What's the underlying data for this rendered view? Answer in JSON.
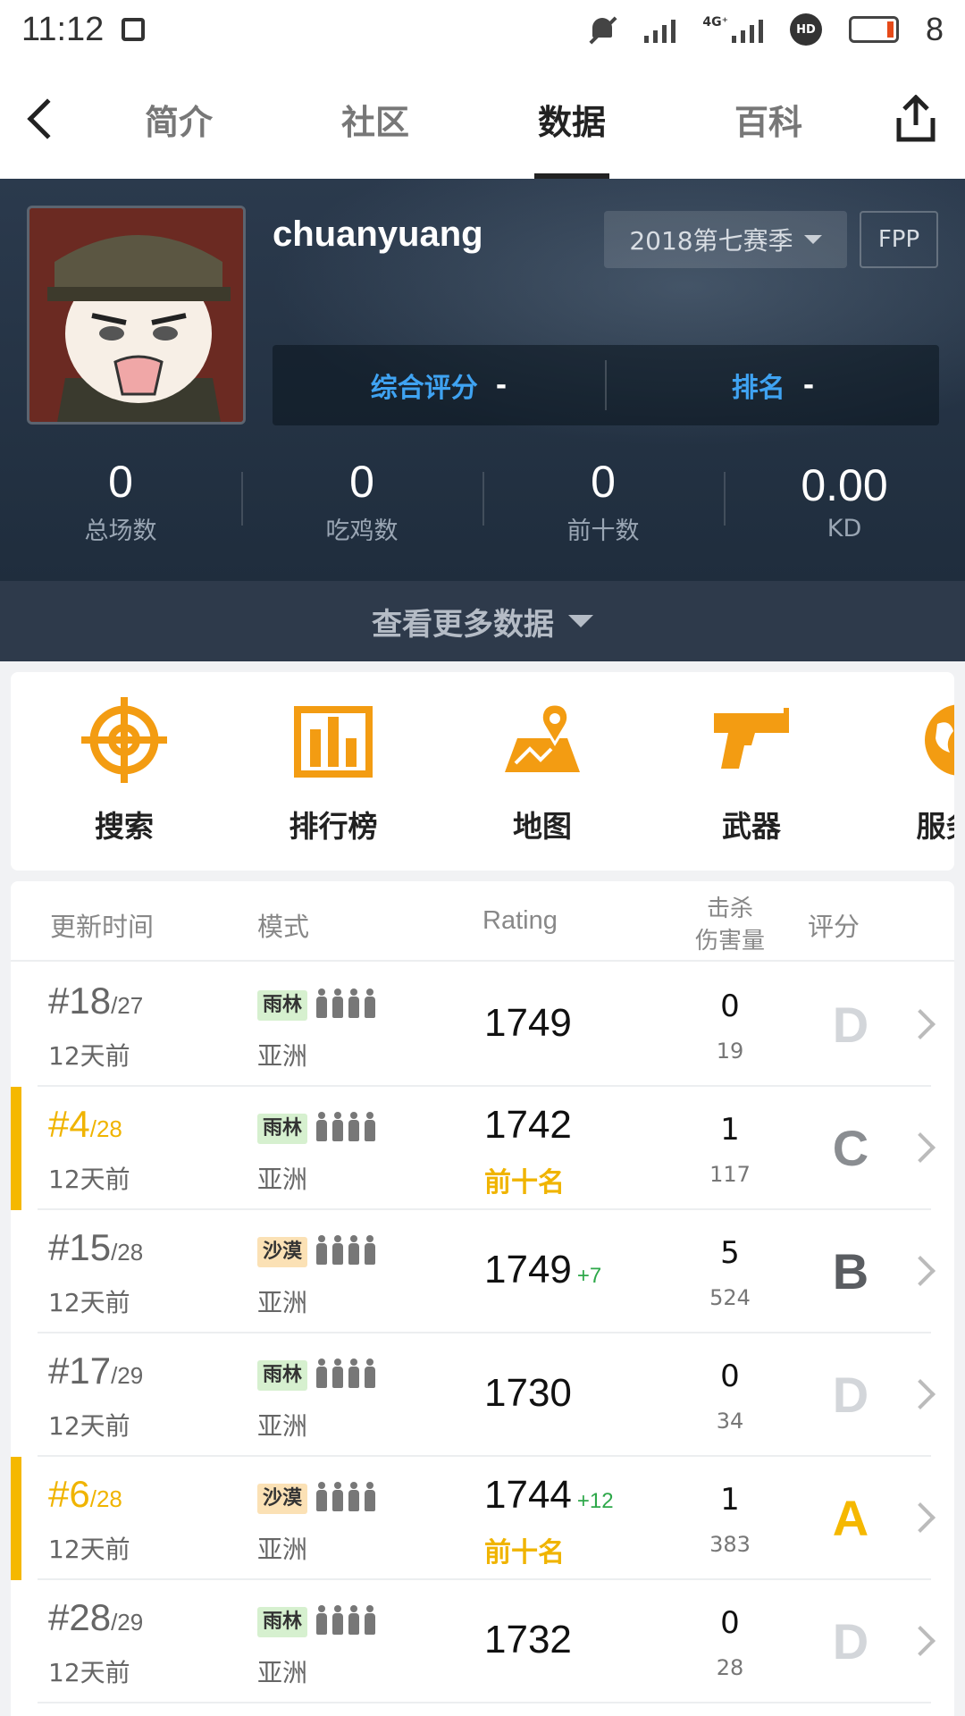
{
  "status_bar": {
    "time": "11:12",
    "network": "4G⁺",
    "hd": "HD",
    "battery": "8"
  },
  "nav": {
    "tabs": [
      "简介",
      "社区",
      "数据",
      "百科"
    ],
    "active_tab": 2
  },
  "profile": {
    "username": "chuanyuang",
    "season": "2018第七赛季",
    "mode": "FPP",
    "overall_rating_label": "综合评分",
    "overall_rating_value": "-",
    "rank_label": "排名",
    "rank_value": "-",
    "stats": [
      {
        "value": "0",
        "label": "总场数"
      },
      {
        "value": "0",
        "label": "吃鸡数"
      },
      {
        "value": "0",
        "label": "前十数"
      },
      {
        "value": "0.00",
        "label": "KD"
      }
    ],
    "more_data": "查看更多数据"
  },
  "quick_menu": [
    {
      "label": "搜索",
      "icon": "crosshair-icon"
    },
    {
      "label": "排行榜",
      "icon": "leaderboard-icon"
    },
    {
      "label": "地图",
      "icon": "map-icon"
    },
    {
      "label": "武器",
      "icon": "pistol-icon"
    },
    {
      "label": "服务器",
      "icon": "globe-icon"
    }
  ],
  "table": {
    "headers": {
      "time": "更新时间",
      "mode": "模式",
      "rating": "Rating",
      "kills_line1": "击杀",
      "kills_line2": "伤害量",
      "grade": "评分"
    },
    "rows": [
      {
        "rank": "#18",
        "total": "/27",
        "ago": "12天前",
        "map": "雨林",
        "map_type": "jungle",
        "region": "亚洲",
        "rating": "1749",
        "delta": "",
        "top10": "",
        "kills": "0",
        "damage": "19",
        "grade": "D",
        "highlight": false
      },
      {
        "rank": "#4",
        "total": "/28",
        "ago": "12天前",
        "map": "雨林",
        "map_type": "jungle",
        "region": "亚洲",
        "rating": "1742",
        "delta": "",
        "top10": "前十名",
        "kills": "1",
        "damage": "117",
        "grade": "C",
        "highlight": true
      },
      {
        "rank": "#15",
        "total": "/28",
        "ago": "12天前",
        "map": "沙漠",
        "map_type": "desert",
        "region": "亚洲",
        "rating": "1749",
        "delta": "+7",
        "top10": "",
        "kills": "5",
        "damage": "524",
        "grade": "B",
        "highlight": false
      },
      {
        "rank": "#17",
        "total": "/29",
        "ago": "12天前",
        "map": "雨林",
        "map_type": "jungle",
        "region": "亚洲",
        "rating": "1730",
        "delta": "",
        "top10": "",
        "kills": "0",
        "damage": "34",
        "grade": "D",
        "highlight": false
      },
      {
        "rank": "#6",
        "total": "/28",
        "ago": "12天前",
        "map": "沙漠",
        "map_type": "desert",
        "region": "亚洲",
        "rating": "1744",
        "delta": "+12",
        "top10": "前十名",
        "kills": "1",
        "damage": "383",
        "grade": "A",
        "highlight": true
      },
      {
        "rank": "#28",
        "total": "/29",
        "ago": "12天前",
        "map": "雨林",
        "map_type": "jungle",
        "region": "亚洲",
        "rating": "1732",
        "delta": "",
        "top10": "",
        "kills": "0",
        "damage": "28",
        "grade": "D",
        "highlight": false
      }
    ]
  },
  "colors": {
    "accent": "#f5b800",
    "header_bg": "#1f2d3d",
    "link_blue": "#3fa3f2",
    "icon_orange": "#f39c12"
  }
}
